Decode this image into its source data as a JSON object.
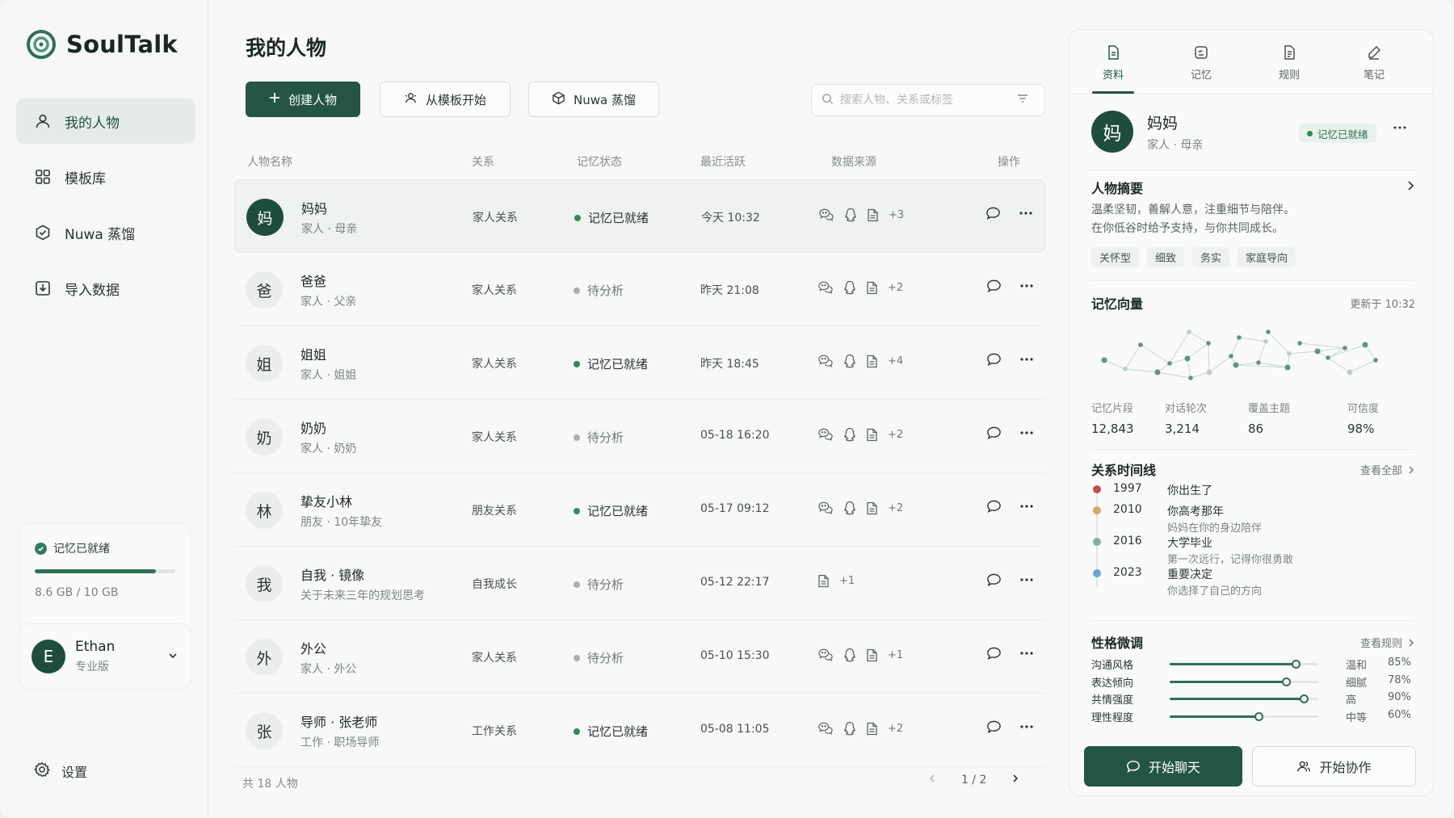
{
  "app": {
    "name": "SoulTalk"
  },
  "sidebar": {
    "items": [
      {
        "label": "我的人物",
        "icon": "user-icon",
        "active": true
      },
      {
        "label": "模板库",
        "icon": "grid-icon"
      },
      {
        "label": "Nuwa 蒸馏",
        "icon": "hexagon-icon"
      },
      {
        "label": "导入数据",
        "icon": "import-icon"
      }
    ],
    "storage": {
      "status": "记忆已就绪",
      "text": "8.6 GB / 10 GB",
      "used_fraction": 0.86
    },
    "user": {
      "initial": "E",
      "name": "Ethan",
      "plan": "专业版"
    },
    "settings_label": "设置"
  },
  "main": {
    "title": "我的人物",
    "create_label": "创建人物",
    "template_label": "从模板开始",
    "nuwa_label": "Nuwa 蒸馏",
    "search_placeholder": "搜索人物、关系或标签",
    "columns": {
      "name": "人物名称",
      "relation": "关系",
      "memory": "记忆状态",
      "active": "最近活跃",
      "source": "数据来源",
      "ops": "操作"
    },
    "rows": [
      {
        "initial": "妈",
        "name": "妈妈",
        "sub": "家人 · 母亲",
        "relation": "家人关系",
        "status": "记忆已就绪",
        "ready": true,
        "time": "今天 10:32",
        "extra": "+3",
        "full_sources": true
      },
      {
        "initial": "爸",
        "name": "爸爸",
        "sub": "家人 · 父亲",
        "relation": "家人关系",
        "status": "待分析",
        "ready": false,
        "time": "昨天 21:08",
        "extra": "+2",
        "full_sources": true
      },
      {
        "initial": "姐",
        "name": "姐姐",
        "sub": "家人 · 姐姐",
        "relation": "家人关系",
        "status": "记忆已就绪",
        "ready": true,
        "time": "昨天 18:45",
        "extra": "+4",
        "full_sources": true
      },
      {
        "initial": "奶",
        "name": "奶奶",
        "sub": "家人 · 奶奶",
        "relation": "家人关系",
        "status": "待分析",
        "ready": false,
        "time": "05-18 16:20",
        "extra": "+2",
        "full_sources": true
      },
      {
        "initial": "林",
        "name": "挚友小林",
        "sub": "朋友 · 10年挚友",
        "relation": "朋友关系",
        "status": "记忆已就绪",
        "ready": true,
        "time": "05-17 09:12",
        "extra": "+2",
        "full_sources": true
      },
      {
        "initial": "我",
        "name": "自我 · 镜像",
        "sub": "关于未来三年的规划思考",
        "relation": "自我成长",
        "status": "待分析",
        "ready": false,
        "time": "05-12 22:17",
        "extra": "+1",
        "full_sources": false
      },
      {
        "initial": "外",
        "name": "外公",
        "sub": "家人 · 外公",
        "relation": "家人关系",
        "status": "待分析",
        "ready": false,
        "time": "05-10 15:30",
        "extra": "+1",
        "full_sources": true
      },
      {
        "initial": "张",
        "name": "导师 · 张老师",
        "sub": "工作 · 职场导师",
        "relation": "工作关系",
        "status": "记忆已就绪",
        "ready": true,
        "time": "05-08 11:05",
        "extra": "+2",
        "full_sources": true
      }
    ],
    "footer": {
      "count": "共 18 人物",
      "page": "1 / 2"
    }
  },
  "panel": {
    "tabs": [
      {
        "label": "资料",
        "icon": "document-icon",
        "active": true
      },
      {
        "label": "记忆",
        "icon": "memory-icon"
      },
      {
        "label": "规则",
        "icon": "rules-icon"
      },
      {
        "label": "笔记",
        "icon": "pen-icon"
      }
    ],
    "person": {
      "initial": "妈",
      "name": "妈妈",
      "sub": "家人 · 母亲",
      "badge": "记忆已就绪"
    },
    "summary": {
      "title": "人物摘要",
      "text_1": "温柔坚韧，善解人意，注重细节与陪伴。",
      "text_2": "在你低谷时给予支持，与你共同成长。",
      "tags": [
        "关怀型",
        "细致",
        "务实",
        "家庭导向"
      ]
    },
    "vector": {
      "title": "记忆向量",
      "updated": "更新于 10:32",
      "stats": [
        {
          "label": "记忆片段",
          "value": "12,843"
        },
        {
          "label": "对话轮次",
          "value": "3,214"
        },
        {
          "label": "覆盖主题",
          "value": "86"
        },
        {
          "label": "可信度",
          "value": "98%"
        }
      ]
    },
    "timeline": {
      "title": "关系时间线",
      "link": "查看全部",
      "items": [
        {
          "year": "1997",
          "title": "你出生了",
          "desc": "",
          "color": "#c0504d"
        },
        {
          "year": "2010",
          "title": "你高考那年",
          "desc": "妈妈在你的身边陪伴",
          "color": "#d9a46a"
        },
        {
          "year": "2016",
          "title": "大学毕业",
          "desc": "第一次远行，记得你很勇敢",
          "color": "#7fb39a"
        },
        {
          "year": "2023",
          "title": "重要决定",
          "desc": "你选择了自己的方向",
          "color": "#6aa6cf"
        }
      ]
    },
    "traits": {
      "title": "性格微调",
      "link": "查看规则",
      "items": [
        {
          "label": "沟通风格",
          "word": "温和",
          "pct": "85%",
          "value": 0.85
        },
        {
          "label": "表达倾向",
          "word": "细腻",
          "pct": "78%",
          "value": 0.78
        },
        {
          "label": "共情强度",
          "word": "高",
          "pct": "90%",
          "value": 0.9
        },
        {
          "label": "理性程度",
          "word": "中等",
          "pct": "60%",
          "value": 0.6
        }
      ]
    },
    "chat_label": "开始聊天",
    "collab_label": "开始协作"
  },
  "colors": {
    "primary": "#245542",
    "ready": "#2e8b5f",
    "pending": "#a9afac"
  }
}
